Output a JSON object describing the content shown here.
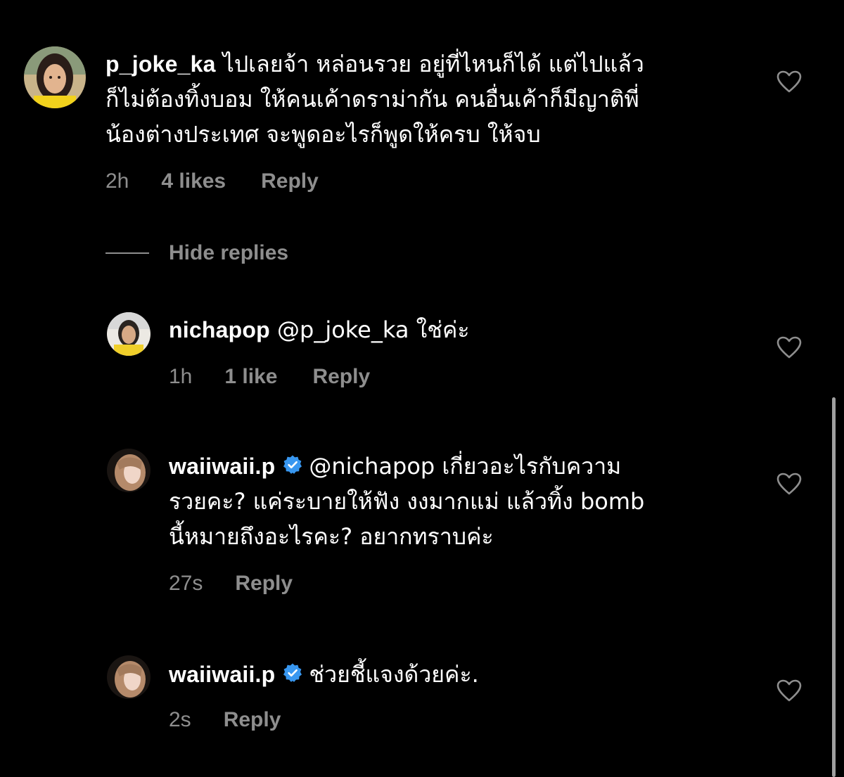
{
  "comments": [
    {
      "username": "p_joke_ka",
      "verified": false,
      "lines": [
        "ไปเลยจ้า หล่อนรวย อยู่ที่ไหนก็ได้ แต่ไปแล้ว",
        "ก็ไม่ต้องทิ้งบอม ให้คนเค้าดราม่ากัน คนอื่นเค้าก็มีญาติพี่",
        "น้องต่างประเทศ จะพูดอะไรก็พูดให้ครบ ให้จบ"
      ],
      "time": "2h",
      "likes": "4 likes",
      "reply": "Reply",
      "avatar_icon": "profile-photo"
    },
    {
      "username": "nichapop",
      "verified": false,
      "mention": "@p_joke_ka",
      "text": "ใช่ค่ะ",
      "time": "1h",
      "likes": "1 like",
      "reply": "Reply",
      "avatar_icon": "profile-photo"
    },
    {
      "username": "waiiwaii.p",
      "verified": true,
      "mention": "@nichapop",
      "first_line_text": "เกี่ยวอะไรกับความ",
      "lines": [
        "รวยคะ? แค่ระบายให้ฟัง งงมากแม่ แล้วทิ้ง bomb",
        "นี้หมายถึงอะไรคะ? อยากทราบค่ะ"
      ],
      "time": "27s",
      "reply": "Reply",
      "avatar_icon": "profile-photo"
    },
    {
      "username": "waiiwaii.p",
      "verified": true,
      "text": "ช่วยชี้แจงด้วยค่ะ.",
      "time": "2s",
      "reply": "Reply",
      "avatar_icon": "profile-photo"
    }
  ],
  "hide_replies_label": "Hide replies",
  "colors": {
    "background": "#000000",
    "text": "#ffffff",
    "meta": "#8e8e8e",
    "verified": "#3897f0"
  },
  "icons": {
    "like": "heart-outline-icon",
    "verified": "verified-badge-icon"
  }
}
